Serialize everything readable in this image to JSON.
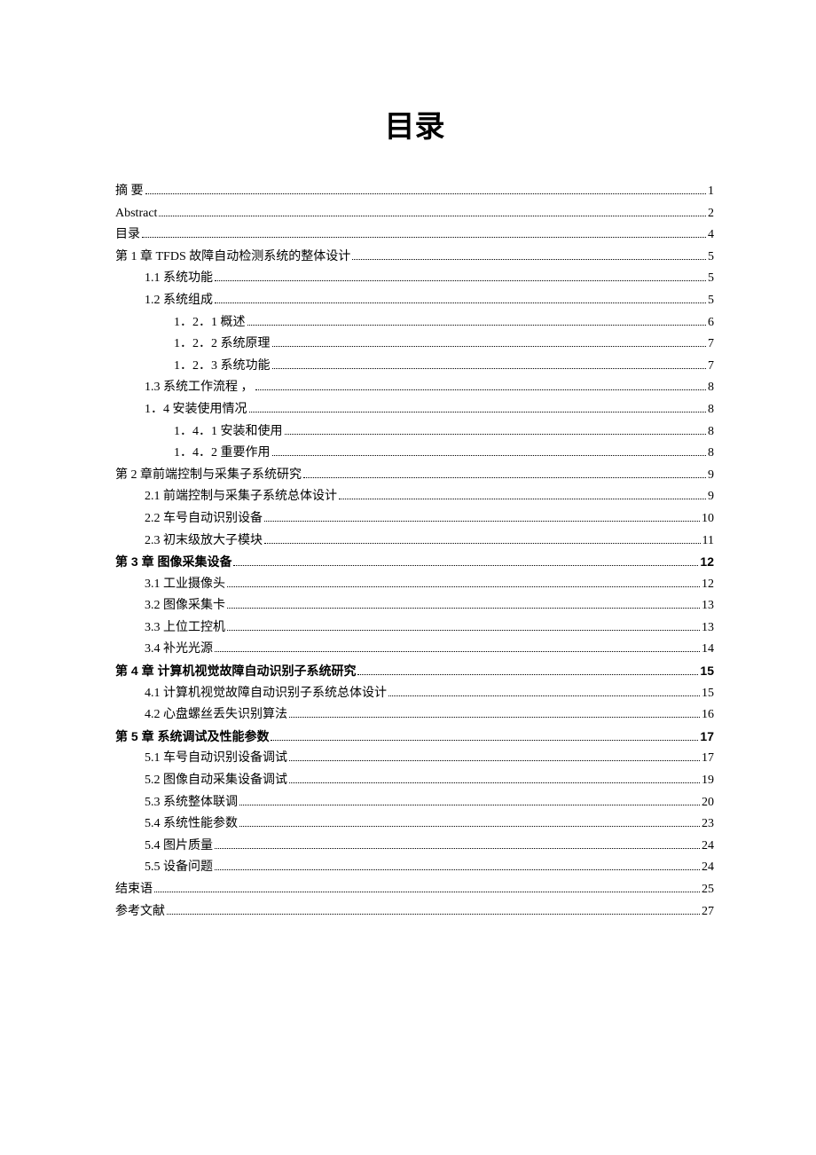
{
  "title": "目录",
  "entries": [
    {
      "label": "摘   要",
      "page": "1",
      "indent": 0,
      "bold": false
    },
    {
      "label": "Abstract",
      "page": "2",
      "indent": 0,
      "bold": false
    },
    {
      "label": "目录",
      "page": "4",
      "indent": 0,
      "bold": false
    },
    {
      "label": "第 1 章 TFDS 故障自动检测系统的整体设计",
      "page": "5",
      "indent": 0,
      "bold": false
    },
    {
      "label": "1.1 系统功能",
      "page": "5",
      "indent": 1,
      "bold": false
    },
    {
      "label": "1.2 系统组成",
      "page": "5",
      "indent": 1,
      "bold": false
    },
    {
      "label": "1．2．1 概述",
      "page": "6",
      "indent": 2,
      "bold": false
    },
    {
      "label": "1．2．2 系统原理",
      "page": "7",
      "indent": 2,
      "bold": false
    },
    {
      "label": "1．2．3 系统功能",
      "page": "7",
      "indent": 2,
      "bold": false
    },
    {
      "label": "1.3 系统工作流程       ，",
      "page": "8",
      "indent": 1,
      "bold": false
    },
    {
      "label": "1．4 安装使用情况",
      "page": "8",
      "indent": 1,
      "bold": false
    },
    {
      "label": "1．4．1 安装和使用",
      "page": "8",
      "indent": 2,
      "bold": false
    },
    {
      "label": "1．4．2 重要作用",
      "page": "8",
      "indent": 2,
      "bold": false
    },
    {
      "label": "第 2 章前端控制与采集子系统研究",
      "page": "9",
      "indent": 0,
      "bold": false
    },
    {
      "label": "2.1 前端控制与采集子系统总体设计",
      "page": "9",
      "indent": 1,
      "bold": false
    },
    {
      "label": "2.2 车号自动识别设备",
      "page": "10",
      "indent": 1,
      "bold": false
    },
    {
      "label": "2.3 初末级放大子模块",
      "page": "11",
      "indent": 1,
      "bold": false
    },
    {
      "label": "第 3 章  图像采集设备",
      "page": "12",
      "indent": 0,
      "bold": true
    },
    {
      "label": "3.1 工业摄像头",
      "page": "12",
      "indent": 1,
      "bold": false
    },
    {
      "label": "3.2 图像采集卡",
      "page": "13",
      "indent": 1,
      "bold": false
    },
    {
      "label": "3.3 上位工控机",
      "page": "13",
      "indent": 1,
      "bold": false
    },
    {
      "label": "3.4 补光光源",
      "page": "14",
      "indent": 1,
      "bold": false
    },
    {
      "label": "第 4 章  计算机视觉故障自动识别子系统研究",
      "page": "15",
      "indent": 0,
      "bold": true
    },
    {
      "label": "4.1 计算机视觉故障自动识别子系统总体设计",
      "page": "15",
      "indent": 1,
      "bold": false
    },
    {
      "label": "4.2 心盘螺丝丢失识别算法",
      "page": "16",
      "indent": 1,
      "bold": false
    },
    {
      "label": "第 5 章  系统调试及性能参数",
      "page": "17",
      "indent": 0,
      "bold": true
    },
    {
      "label": "5.1 车号自动识别设备调试",
      "page": "17",
      "indent": 1,
      "bold": false
    },
    {
      "label": "5.2 图像自动采集设备调试",
      "page": "19",
      "indent": 1,
      "bold": false
    },
    {
      "label": "5.3 系统整体联调",
      "page": "20",
      "indent": 1,
      "bold": false
    },
    {
      "label": "5.4 系统性能参数",
      "page": "23",
      "indent": 1,
      "bold": false
    },
    {
      "label": "5.4 图片质量",
      "page": "24",
      "indent": 1,
      "bold": false
    },
    {
      "label": "5.5 设备问题",
      "page": "24",
      "indent": 1,
      "bold": false
    },
    {
      "label": "结束语",
      "page": "25",
      "indent": 0,
      "bold": false
    },
    {
      "label": "参考文献",
      "page": "27",
      "indent": 0,
      "bold": false
    }
  ]
}
